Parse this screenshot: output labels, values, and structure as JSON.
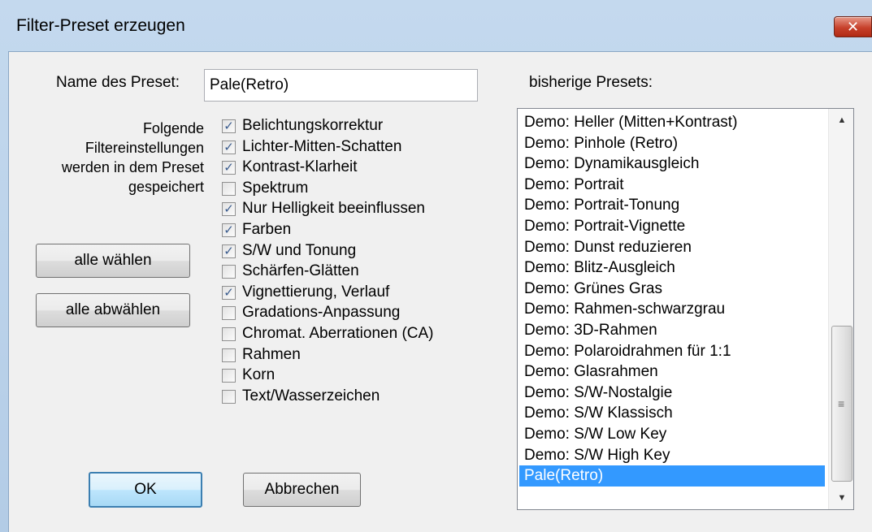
{
  "window": {
    "title": "Filter-Preset erzeugen",
    "close_label": "✕"
  },
  "name": {
    "label": "Name des Preset:",
    "value": "Pale(Retro)"
  },
  "description": [
    "Folgende",
    "Filtereinstellungen",
    "werden in dem Preset",
    "gespeichert"
  ],
  "checks": [
    {
      "label": "Belichtungskorrektur",
      "checked": true
    },
    {
      "label": "Lichter-Mitten-Schatten",
      "checked": true
    },
    {
      "label": "Kontrast-Klarheit",
      "checked": true
    },
    {
      "label": "Spektrum",
      "checked": false
    },
    {
      "label": "Nur Helligkeit beeinflussen",
      "checked": true
    },
    {
      "label": "Farben",
      "checked": true
    },
    {
      "label": "S/W und Tonung",
      "checked": true
    },
    {
      "label": "Schärfen-Glätten",
      "checked": false
    },
    {
      "label": "Vignettierung, Verlauf",
      "checked": true
    },
    {
      "label": "Gradations-Anpassung",
      "checked": false
    },
    {
      "label": "Chromat. Aberrationen (CA)",
      "checked": false
    },
    {
      "label": "Rahmen",
      "checked": false
    },
    {
      "label": "Korn",
      "checked": false
    },
    {
      "label": "Text/Wasserzeichen",
      "checked": false
    }
  ],
  "buttons": {
    "select_all": "alle wählen",
    "deselect_all": "alle abwählen",
    "ok": "OK",
    "cancel": "Abbrechen"
  },
  "presets": {
    "label": "bisherige Presets:",
    "selected": "Pale(Retro)",
    "items": [
      "Demo: Heller (Mitten+Kontrast)",
      "Demo: Pinhole (Retro)",
      "Demo: Dynamikausgleich",
      "Demo: Portrait",
      "Demo: Portrait-Tonung",
      "Demo: Portrait-Vignette",
      "Demo: Dunst reduzieren",
      "Demo: Blitz-Ausgleich",
      "Demo: Grünes Gras",
      "Demo: Rahmen-schwarzgrau",
      "Demo: 3D-Rahmen",
      "Demo: Polaroidrahmen für 1:1",
      "Demo: Glasrahmen",
      "Demo: S/W-Nostalgie",
      "Demo: S/W Klassisch",
      "Demo: S/W Low Key",
      "Demo: S/W High Key",
      "Pale(Retro)"
    ]
  },
  "icons": {
    "check": "check-icon",
    "up": "scroll-up-icon",
    "down": "scroll-down-icon",
    "grip": "grip-icon"
  }
}
